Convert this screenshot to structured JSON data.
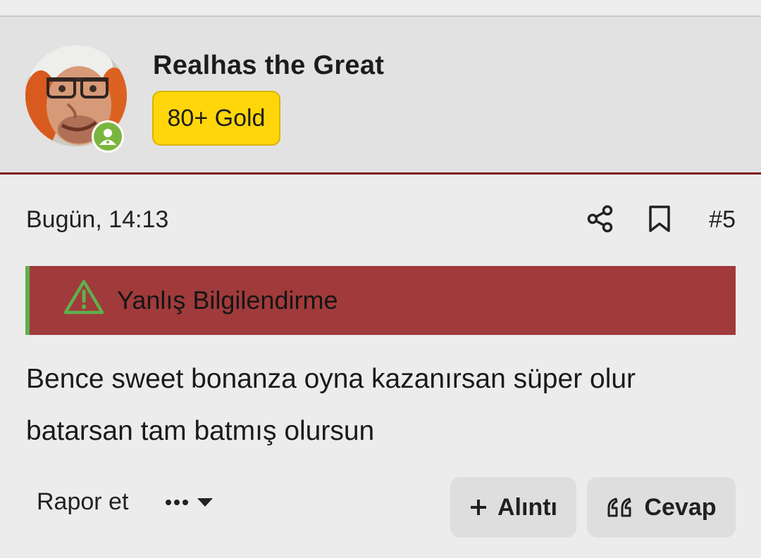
{
  "post": {
    "author": {
      "name": "Realhas the Great",
      "badge": "80+ Gold",
      "online": true
    },
    "timestamp": "Bugün, 14:13",
    "post_number": "#5",
    "warning": {
      "label": "Yanlış Bilgilendirme",
      "icon": "warning-triangle-icon"
    },
    "body_lines": [
      "Bence sweet bonanza oyna kazanırsan süper olur",
      "batarsan tam batmış olursun"
    ],
    "actions": {
      "report": "Rapor et",
      "quote": "Alıntı",
      "reply": "Cevap"
    }
  },
  "colors": {
    "header_bg": "#e2e2e2",
    "header_border": "#7a1818",
    "badge_bg": "#ffd60a",
    "warning_bg": "#a13a3b",
    "warning_accent": "#5eb04c",
    "online": "#7ab63f"
  }
}
